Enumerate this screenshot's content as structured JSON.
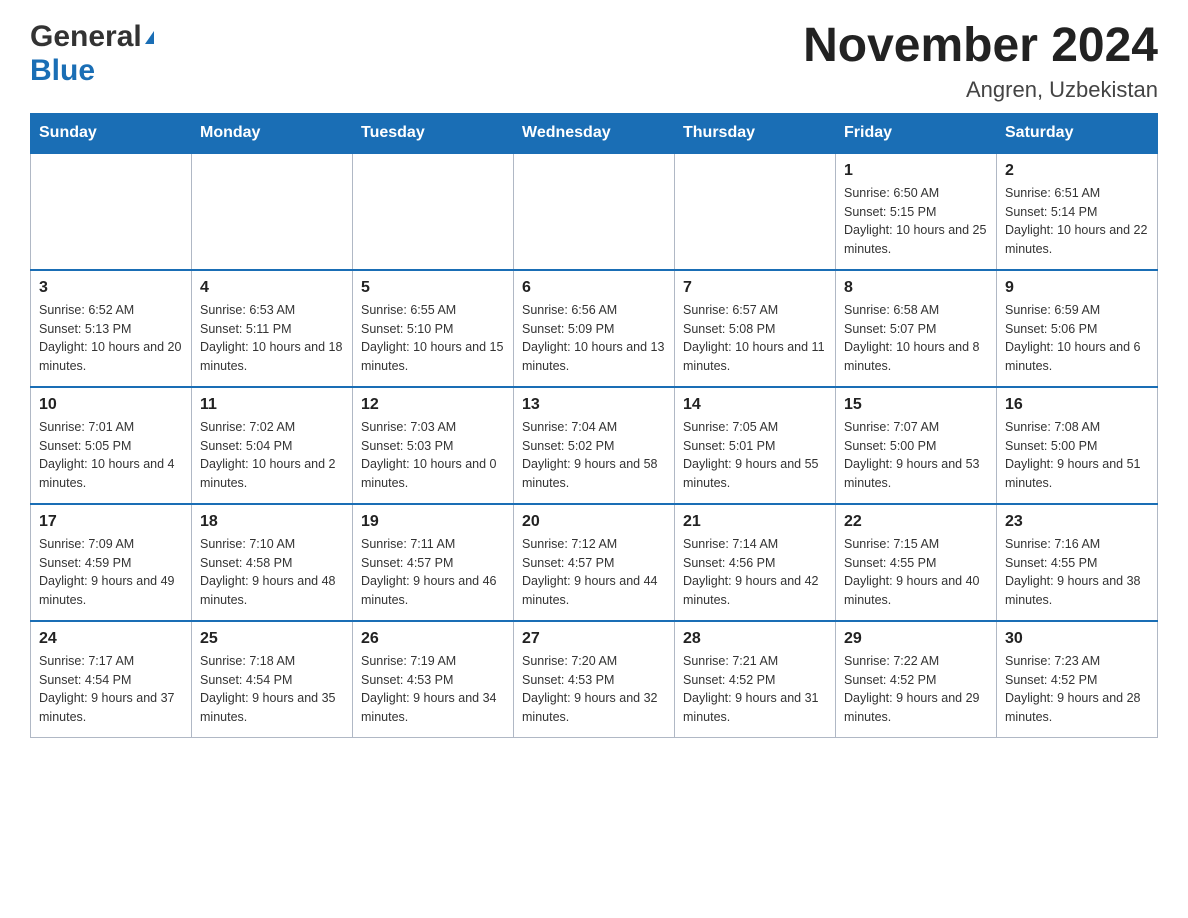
{
  "header": {
    "logo_general": "General",
    "logo_blue": "Blue",
    "month_title": "November 2024",
    "location": "Angren, Uzbekistan"
  },
  "weekdays": [
    "Sunday",
    "Monday",
    "Tuesday",
    "Wednesday",
    "Thursday",
    "Friday",
    "Saturday"
  ],
  "weeks": [
    [
      {
        "day": "",
        "info": ""
      },
      {
        "day": "",
        "info": ""
      },
      {
        "day": "",
        "info": ""
      },
      {
        "day": "",
        "info": ""
      },
      {
        "day": "",
        "info": ""
      },
      {
        "day": "1",
        "info": "Sunrise: 6:50 AM\nSunset: 5:15 PM\nDaylight: 10 hours and 25 minutes."
      },
      {
        "day": "2",
        "info": "Sunrise: 6:51 AM\nSunset: 5:14 PM\nDaylight: 10 hours and 22 minutes."
      }
    ],
    [
      {
        "day": "3",
        "info": "Sunrise: 6:52 AM\nSunset: 5:13 PM\nDaylight: 10 hours and 20 minutes."
      },
      {
        "day": "4",
        "info": "Sunrise: 6:53 AM\nSunset: 5:11 PM\nDaylight: 10 hours and 18 minutes."
      },
      {
        "day": "5",
        "info": "Sunrise: 6:55 AM\nSunset: 5:10 PM\nDaylight: 10 hours and 15 minutes."
      },
      {
        "day": "6",
        "info": "Sunrise: 6:56 AM\nSunset: 5:09 PM\nDaylight: 10 hours and 13 minutes."
      },
      {
        "day": "7",
        "info": "Sunrise: 6:57 AM\nSunset: 5:08 PM\nDaylight: 10 hours and 11 minutes."
      },
      {
        "day": "8",
        "info": "Sunrise: 6:58 AM\nSunset: 5:07 PM\nDaylight: 10 hours and 8 minutes."
      },
      {
        "day": "9",
        "info": "Sunrise: 6:59 AM\nSunset: 5:06 PM\nDaylight: 10 hours and 6 minutes."
      }
    ],
    [
      {
        "day": "10",
        "info": "Sunrise: 7:01 AM\nSunset: 5:05 PM\nDaylight: 10 hours and 4 minutes."
      },
      {
        "day": "11",
        "info": "Sunrise: 7:02 AM\nSunset: 5:04 PM\nDaylight: 10 hours and 2 minutes."
      },
      {
        "day": "12",
        "info": "Sunrise: 7:03 AM\nSunset: 5:03 PM\nDaylight: 10 hours and 0 minutes."
      },
      {
        "day": "13",
        "info": "Sunrise: 7:04 AM\nSunset: 5:02 PM\nDaylight: 9 hours and 58 minutes."
      },
      {
        "day": "14",
        "info": "Sunrise: 7:05 AM\nSunset: 5:01 PM\nDaylight: 9 hours and 55 minutes."
      },
      {
        "day": "15",
        "info": "Sunrise: 7:07 AM\nSunset: 5:00 PM\nDaylight: 9 hours and 53 minutes."
      },
      {
        "day": "16",
        "info": "Sunrise: 7:08 AM\nSunset: 5:00 PM\nDaylight: 9 hours and 51 minutes."
      }
    ],
    [
      {
        "day": "17",
        "info": "Sunrise: 7:09 AM\nSunset: 4:59 PM\nDaylight: 9 hours and 49 minutes."
      },
      {
        "day": "18",
        "info": "Sunrise: 7:10 AM\nSunset: 4:58 PM\nDaylight: 9 hours and 48 minutes."
      },
      {
        "day": "19",
        "info": "Sunrise: 7:11 AM\nSunset: 4:57 PM\nDaylight: 9 hours and 46 minutes."
      },
      {
        "day": "20",
        "info": "Sunrise: 7:12 AM\nSunset: 4:57 PM\nDaylight: 9 hours and 44 minutes."
      },
      {
        "day": "21",
        "info": "Sunrise: 7:14 AM\nSunset: 4:56 PM\nDaylight: 9 hours and 42 minutes."
      },
      {
        "day": "22",
        "info": "Sunrise: 7:15 AM\nSunset: 4:55 PM\nDaylight: 9 hours and 40 minutes."
      },
      {
        "day": "23",
        "info": "Sunrise: 7:16 AM\nSunset: 4:55 PM\nDaylight: 9 hours and 38 minutes."
      }
    ],
    [
      {
        "day": "24",
        "info": "Sunrise: 7:17 AM\nSunset: 4:54 PM\nDaylight: 9 hours and 37 minutes."
      },
      {
        "day": "25",
        "info": "Sunrise: 7:18 AM\nSunset: 4:54 PM\nDaylight: 9 hours and 35 minutes."
      },
      {
        "day": "26",
        "info": "Sunrise: 7:19 AM\nSunset: 4:53 PM\nDaylight: 9 hours and 34 minutes."
      },
      {
        "day": "27",
        "info": "Sunrise: 7:20 AM\nSunset: 4:53 PM\nDaylight: 9 hours and 32 minutes."
      },
      {
        "day": "28",
        "info": "Sunrise: 7:21 AM\nSunset: 4:52 PM\nDaylight: 9 hours and 31 minutes."
      },
      {
        "day": "29",
        "info": "Sunrise: 7:22 AM\nSunset: 4:52 PM\nDaylight: 9 hours and 29 minutes."
      },
      {
        "day": "30",
        "info": "Sunrise: 7:23 AM\nSunset: 4:52 PM\nDaylight: 9 hours and 28 minutes."
      }
    ]
  ]
}
